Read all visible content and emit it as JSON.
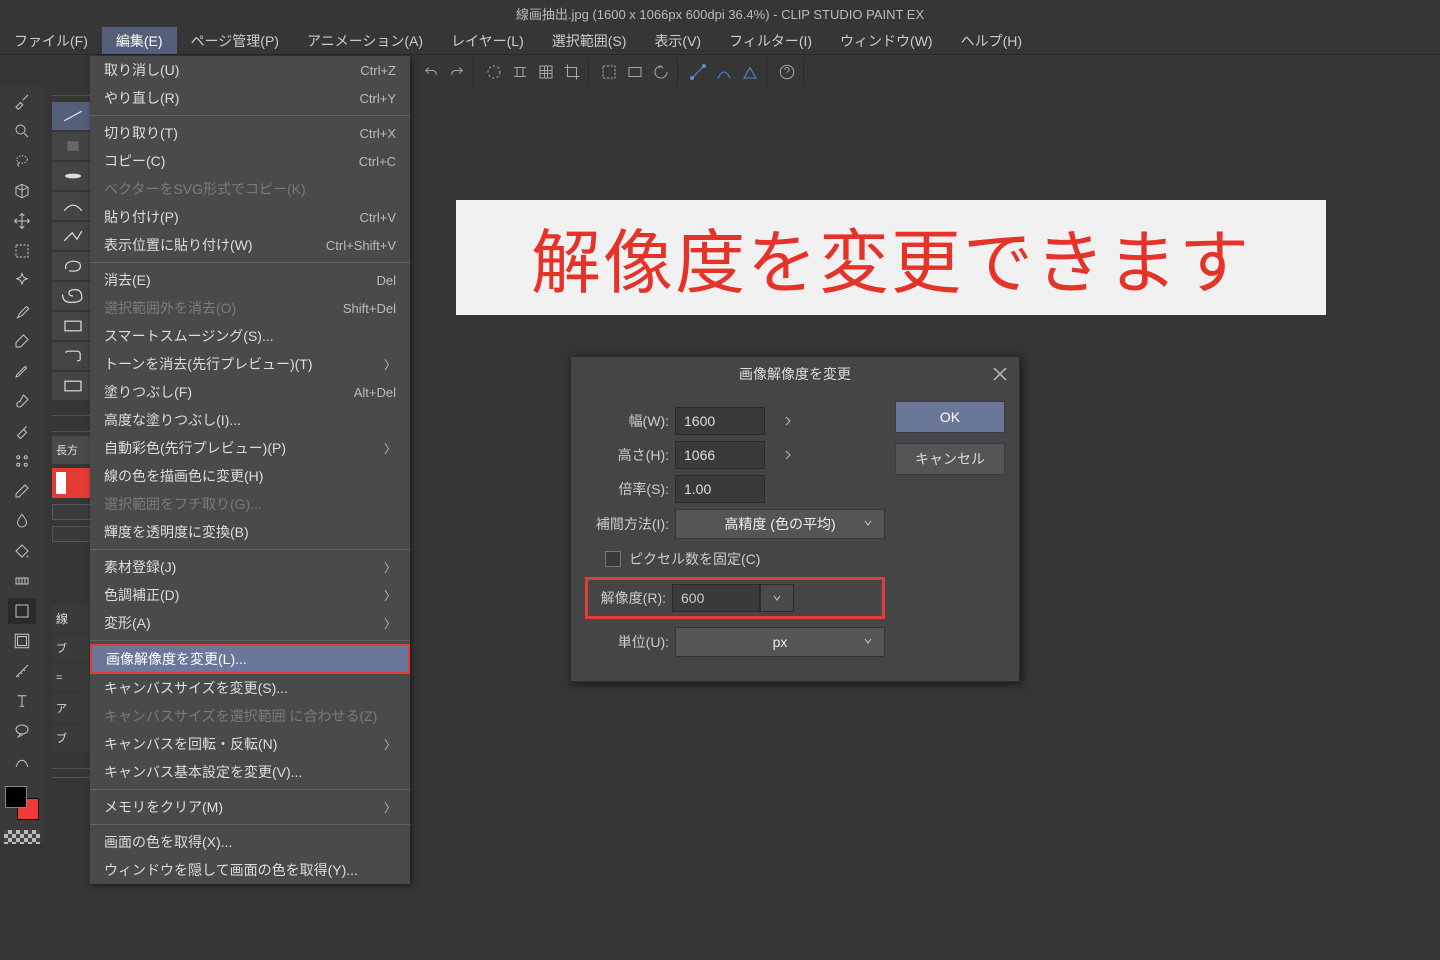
{
  "title": "線画抽出.jpg (1600 x 1066px 600dpi 36.4%)  - CLIP STUDIO PAINT EX",
  "menubar": {
    "file": "ファイル(F)",
    "edit": "編集(E)",
    "page": "ページ管理(P)",
    "anim": "アニメーション(A)",
    "layer": "レイヤー(L)",
    "select": "選択範囲(S)",
    "view": "表示(V)",
    "filter": "フィルター(I)",
    "window": "ウィンドウ(W)",
    "help": "ヘルプ(H)"
  },
  "dropdown": {
    "undo": {
      "label": "取り消し(U)",
      "shortcut": "Ctrl+Z"
    },
    "redo": {
      "label": "やり直し(R)",
      "shortcut": "Ctrl+Y"
    },
    "cut": {
      "label": "切り取り(T)",
      "shortcut": "Ctrl+X"
    },
    "copy": {
      "label": "コピー(C)",
      "shortcut": "Ctrl+C"
    },
    "svgcopy": {
      "label": "ベクターをSVG形式でコピー(K)",
      "shortcut": ""
    },
    "paste": {
      "label": "貼り付け(P)",
      "shortcut": "Ctrl+V"
    },
    "pasteat": {
      "label": "表示位置に貼り付け(W)",
      "shortcut": "Ctrl+Shift+V"
    },
    "clear": {
      "label": "消去(E)",
      "shortcut": "Del"
    },
    "clearout": {
      "label": "選択範囲外を消去(O)",
      "shortcut": "Shift+Del"
    },
    "smart": {
      "label": "スマートスムージング(S)...",
      "shortcut": ""
    },
    "tone": {
      "label": "トーンを消去(先行プレビュー)(T)",
      "shortcut": ""
    },
    "fill": {
      "label": "塗りつぶし(F)",
      "shortcut": "Alt+Del"
    },
    "advfill": {
      "label": "高度な塗りつぶし(I)...",
      "shortcut": ""
    },
    "autocolor": {
      "label": "自動彩色(先行プレビュー)(P)",
      "shortcut": ""
    },
    "linecolor": {
      "label": "線の色を描画色に変更(H)",
      "shortcut": ""
    },
    "border": {
      "label": "選択範囲をフチ取り(G)...",
      "shortcut": ""
    },
    "lumalpha": {
      "label": "輝度を透明度に変換(B)",
      "shortcut": ""
    },
    "material": {
      "label": "素材登録(J)",
      "shortcut": ""
    },
    "tonecorr": {
      "label": "色調補正(D)",
      "shortcut": ""
    },
    "transform": {
      "label": "変形(A)",
      "shortcut": ""
    },
    "imageres": {
      "label": "画像解像度を変更(L)...",
      "shortcut": ""
    },
    "canvassize": {
      "label": "キャンバスサイズを変更(S)...",
      "shortcut": ""
    },
    "canvasselect": {
      "label": "キャンバスサイズを選択範囲 に合わせる(Z)",
      "shortcut": ""
    },
    "canvasrotate": {
      "label": "キャンバスを回転・反転(N)",
      "shortcut": ""
    },
    "canvasbasic": {
      "label": "キャンバス基本設定を変更(V)...",
      "shortcut": ""
    },
    "clearmem": {
      "label": "メモリをクリア(M)",
      "shortcut": ""
    },
    "pickcolor": {
      "label": "画面の色を取得(X)...",
      "shortcut": ""
    },
    "hidewin": {
      "label": "ウィンドウを隠して画面の色を取得(Y)...",
      "shortcut": ""
    }
  },
  "overlay_text": "解像度を変更できます",
  "dialog": {
    "title": "画像解像度を変更",
    "width_label": "幅(W):",
    "width_value": "1600",
    "height_label": "高さ(H):",
    "height_value": "1066",
    "scale_label": "倍率(S):",
    "scale_value": "1.00",
    "interp_label": "補間方法(I):",
    "interp_value": "高精度 (色の平均)",
    "fixpixel_label": "ピクセル数を固定(C)",
    "res_label": "解像度(R):",
    "res_value": "600",
    "unit_label": "単位(U):",
    "unit_value": "px",
    "ok": "OK",
    "cancel": "キャンセル"
  },
  "subpanel": {
    "label": "長方"
  },
  "colors": {
    "accent": "#6b7799",
    "highlight_border": "#e43b36",
    "overlay_text": "#e6332a"
  }
}
